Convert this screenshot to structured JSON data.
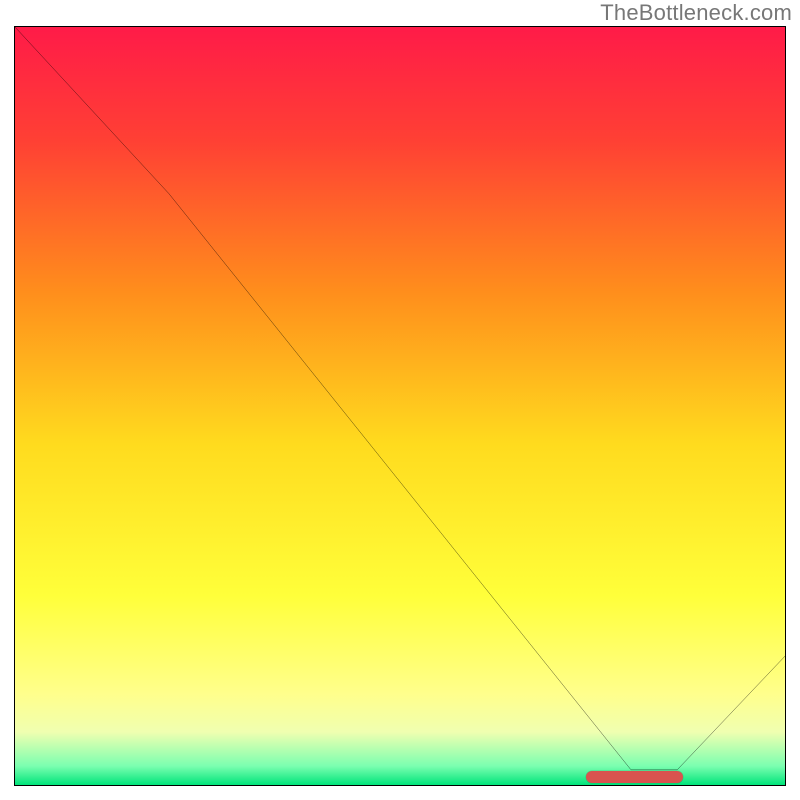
{
  "watermark_text": "TheBottleneck.com",
  "chart_data": {
    "type": "line",
    "title": "",
    "xlabel": "",
    "ylabel": "",
    "xlim": [
      0,
      100
    ],
    "ylim": [
      0,
      100
    ],
    "series": [
      {
        "name": "bottleneck-curve",
        "x": [
          0,
          20,
          80,
          86,
          100
        ],
        "y": [
          100,
          78,
          2,
          2,
          17
        ]
      }
    ],
    "marker": {
      "name": "optimal-range",
      "x_start": 74,
      "x_end": 86.5,
      "y": 1.3,
      "color": "#d9534f"
    },
    "background_gradient": {
      "stops": [
        {
          "offset": 0.0,
          "color": "#ff1b48"
        },
        {
          "offset": 0.15,
          "color": "#ff4034"
        },
        {
          "offset": 0.35,
          "color": "#ff8e1c"
        },
        {
          "offset": 0.55,
          "color": "#ffdb1e"
        },
        {
          "offset": 0.75,
          "color": "#ffff3a"
        },
        {
          "offset": 0.88,
          "color": "#ffff8c"
        },
        {
          "offset": 0.93,
          "color": "#f0ffb0"
        },
        {
          "offset": 0.975,
          "color": "#7bffb0"
        },
        {
          "offset": 1.0,
          "color": "#00e47a"
        }
      ]
    }
  }
}
